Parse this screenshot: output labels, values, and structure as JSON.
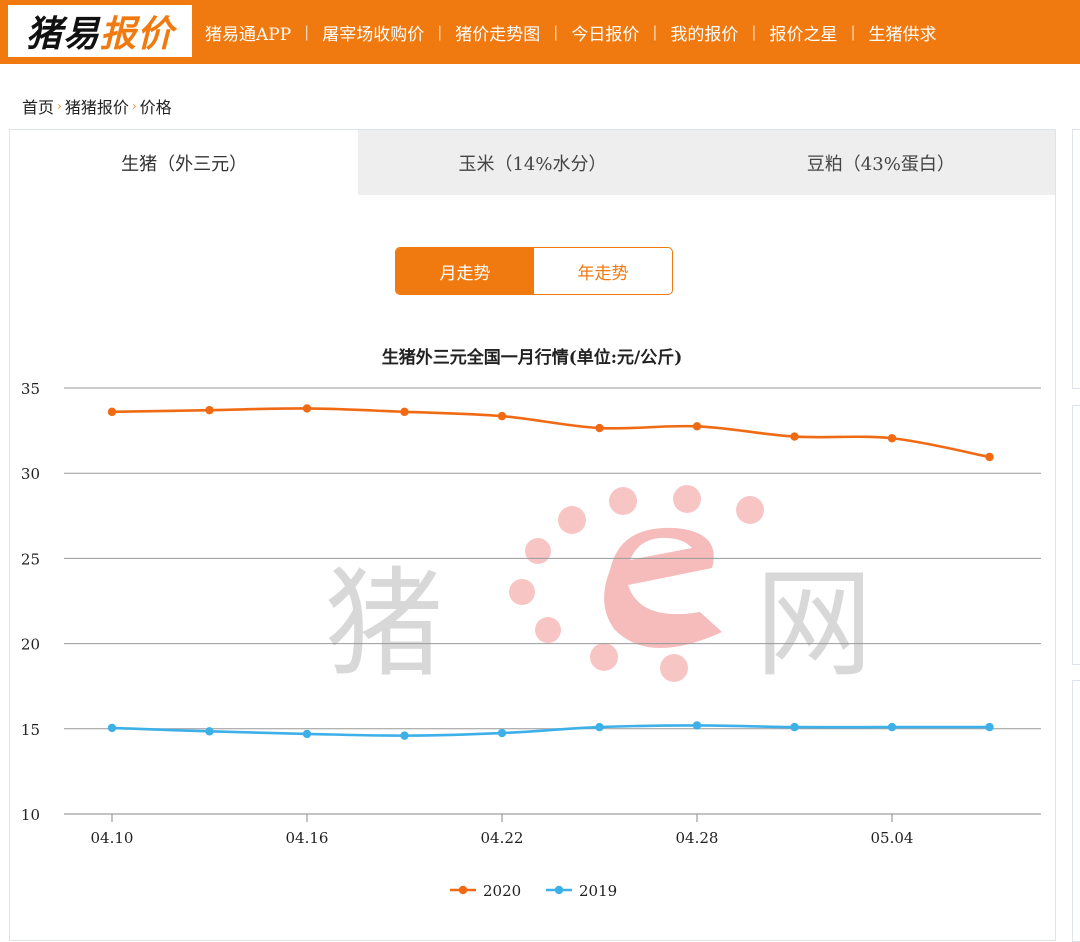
{
  "header": {
    "logo_part1": "猪易",
    "logo_part2": "报价",
    "nav": [
      "猪易通APP",
      "屠宰场收购价",
      "猪价走势图",
      "今日报价",
      "我的报价",
      "报价之星",
      "生猪供求"
    ]
  },
  "breadcrumb": [
    "首页",
    "猪猪报价",
    "价格"
  ],
  "tabs": [
    {
      "label": "生猪（外三元）",
      "active": true
    },
    {
      "label": "玉米（14%水分）",
      "active": false
    },
    {
      "label": "豆粕（43%蛋白）",
      "active": false
    }
  ],
  "toggle": {
    "month": "月走势",
    "year": "年走势",
    "active": "month"
  },
  "watermark": {
    "left": "猪",
    "right": "网"
  },
  "colors": {
    "brand": "#f07a10",
    "series_2020": "#f06a14",
    "series_2019": "#3db0e8"
  },
  "chart_data": {
    "type": "line",
    "title": "生猪外三元全国一月行情(单位:元/公斤)",
    "x": [
      "04.10",
      "04.13",
      "04.16",
      "04.19",
      "04.22",
      "04.25",
      "04.28",
      "05.01",
      "05.04",
      "05.07"
    ],
    "x_tick_labels": [
      "04.10",
      "04.16",
      "04.22",
      "04.28",
      "05.04"
    ],
    "y_ticks": [
      10,
      15,
      20,
      25,
      30,
      35
    ],
    "ylim": [
      10,
      35
    ],
    "series": [
      {
        "name": "2020",
        "values": [
          33.6,
          33.7,
          33.8,
          33.6,
          33.35,
          32.65,
          32.75,
          32.15,
          32.05,
          30.95
        ]
      },
      {
        "name": "2019",
        "values": [
          15.05,
          14.85,
          14.7,
          14.6,
          14.75,
          15.1,
          15.2,
          15.1,
          15.1,
          15.1
        ]
      }
    ],
    "grid": true,
    "legend": "bottom-center"
  }
}
